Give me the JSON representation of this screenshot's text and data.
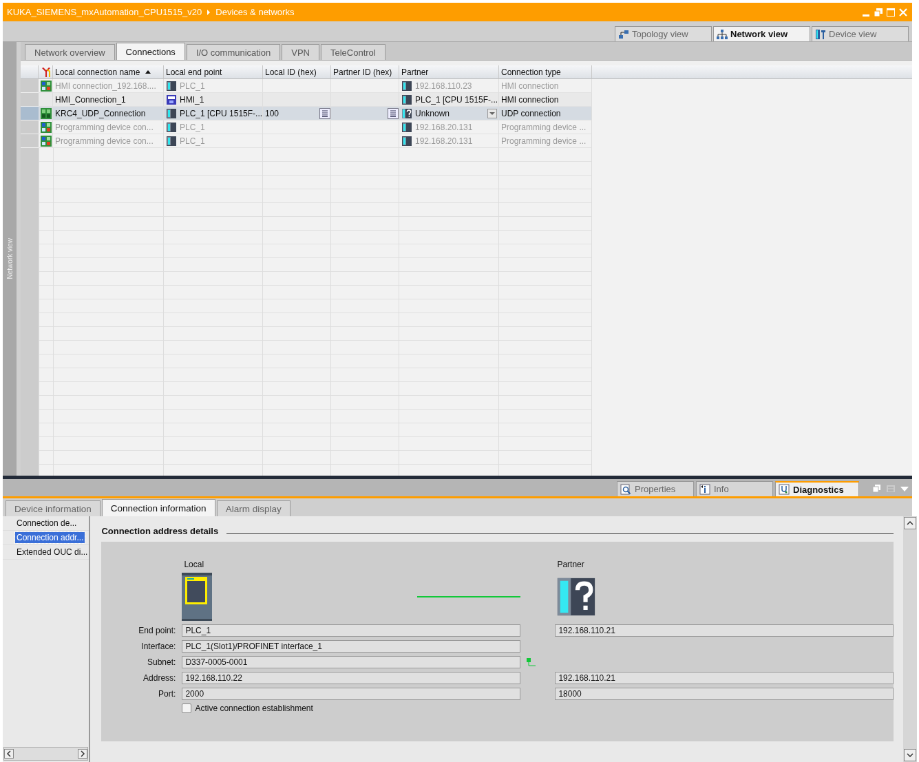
{
  "title_bar": {
    "breadcrumb": [
      "KUKA_SIEMENS_mxAutomation_CPU1515_v20",
      "Devices & networks"
    ]
  },
  "view_tabs": [
    {
      "label": "Topology view",
      "selected": false
    },
    {
      "label": "Network view",
      "selected": true
    },
    {
      "label": "Device view",
      "selected": false
    }
  ],
  "side_strip": {
    "label": "Network view"
  },
  "editor_tabs": [
    {
      "label": "Network overview",
      "selected": false
    },
    {
      "label": "Connections",
      "selected": true
    },
    {
      "label": "I/O communication",
      "selected": false
    },
    {
      "label": "VPN",
      "selected": false
    },
    {
      "label": "TeleControl",
      "selected": false
    }
  ],
  "table": {
    "columns": [
      {
        "label": "Local connection name",
        "sorted": true
      },
      {
        "label": "Local end point",
        "sorted": false
      },
      {
        "label": "Local ID (hex)",
        "sorted": false
      },
      {
        "label": "Partner ID (hex)",
        "sorted": false
      },
      {
        "label": "Partner",
        "sorted": false
      },
      {
        "label": "Connection type",
        "sorted": false
      }
    ],
    "rows": [
      {
        "kind": "multi",
        "name": "HMI connection_192.168....",
        "end_point": {
          "kind": "plc",
          "label": "PLC_1"
        },
        "partner": {
          "kind": "plc",
          "label": "192.168.110.23"
        },
        "type": "HMI connection",
        "disabled": true,
        "selected": false
      },
      {
        "kind": "plain",
        "name": "HMI_Connection_1",
        "end_point": {
          "kind": "hmi",
          "label": "HMI_1"
        },
        "partner": {
          "kind": "plc",
          "label": "PLC_1 [CPU 1515F-..."
        },
        "type": "HMI connection",
        "disabled": false,
        "selected": false
      },
      {
        "kind": "udp",
        "name": "KRC4_UDP_Connection",
        "end_point": {
          "kind": "plc",
          "label": "PLC_1 [CPU 1515F-..."
        },
        "local_id": "100",
        "partner": {
          "kind": "unknown",
          "label": "Unknown"
        },
        "type": "UDP connection",
        "disabled": false,
        "selected": true
      },
      {
        "kind": "multi",
        "name": "Programming device con...",
        "end_point": {
          "kind": "plc",
          "label": "PLC_1"
        },
        "partner": {
          "kind": "plc",
          "label": "192.168.20.131"
        },
        "type": "Programming device ...",
        "disabled": true,
        "selected": false
      },
      {
        "kind": "multi",
        "name": "Programming device con...",
        "end_point": {
          "kind": "plc",
          "label": "PLC_1"
        },
        "partner": {
          "kind": "plc",
          "label": "192.168.20.131"
        },
        "type": "Programming device ...",
        "disabled": true,
        "selected": false
      }
    ]
  },
  "inspector_tabs": [
    {
      "label": "Properties",
      "selected": false
    },
    {
      "label": "Info",
      "selected": false
    },
    {
      "label": "Diagnostics",
      "selected": true
    }
  ],
  "sub_tabs": [
    {
      "label": "Device information",
      "selected": false
    },
    {
      "label": "Connection information",
      "selected": true
    },
    {
      "label": "Alarm display",
      "selected": false
    }
  ],
  "nav": [
    {
      "label": "Connection de...",
      "selected": false
    },
    {
      "label": "Connection addr...",
      "selected": true
    },
    {
      "label": "Extended OUC di...",
      "selected": false
    }
  ],
  "details": {
    "title": "Connection address details",
    "local_label": "Local",
    "partner_label": "Partner",
    "fields": [
      {
        "label": "End point:",
        "local": "PLC_1",
        "partner": "192.168.110.21"
      },
      {
        "label": "Interface:",
        "local": "PLC_1(Slot1)/PROFINET interface_1"
      },
      {
        "label": "Subnet:",
        "local": "D337-0005-0001",
        "linked": true
      },
      {
        "label": "Address:",
        "local": "192.168.110.22",
        "partner": "192.168.110.21"
      },
      {
        "label": "Port:",
        "local": "2000",
        "partner": "18000"
      }
    ],
    "checkbox": {
      "label": "Active connection establishment",
      "checked": false
    }
  }
}
